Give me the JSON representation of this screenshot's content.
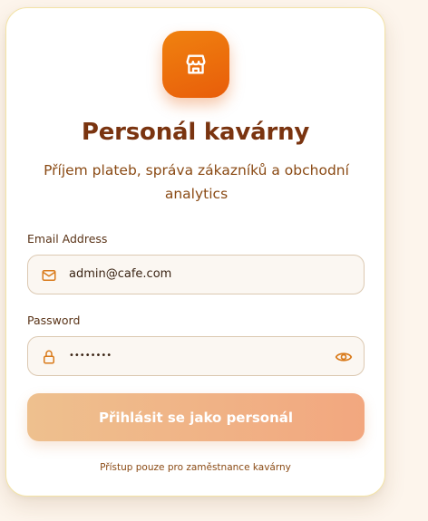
{
  "header": {
    "logo_icon": "store-icon",
    "title": "Personál kavárny",
    "subtitle": "Příjem plateb, správa zákazníků a obchodní analytics"
  },
  "form": {
    "email": {
      "label": "Email Address",
      "value": "admin@cafe.com",
      "icon": "mail-icon"
    },
    "password": {
      "label": "Password",
      "value": "••••••••",
      "icon": "lock-icon",
      "toggle_icon": "eye-icon"
    },
    "submit_label": "Přihlásit se jako personál"
  },
  "footer": {
    "note": "Přístup pouze pro zaměstnance kavárny"
  },
  "colors": {
    "accent": "#e8650a",
    "title": "#7a3410",
    "background": "#fdf5ec"
  }
}
